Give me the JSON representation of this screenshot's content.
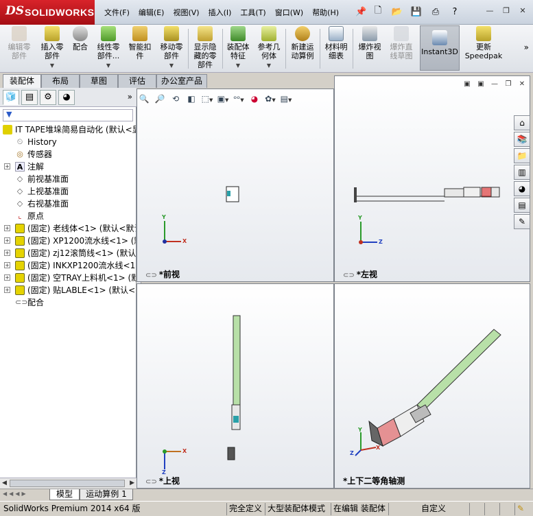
{
  "app": {
    "logo_ds": "DS",
    "logo_name": "SOLIDWORKS"
  },
  "menu": [
    "文件(F)",
    "编辑(E)",
    "视图(V)",
    "插入(I)",
    "工具(T)",
    "窗口(W)",
    "帮助(H)"
  ],
  "quick": [
    "new-icon",
    "open-icon",
    "save-icon",
    "print-icon",
    "help-icon"
  ],
  "command_manager": {
    "buttons": [
      {
        "label": "编辑零\n部件",
        "disabled": true
      },
      {
        "label": "插入零\n部件",
        "disabled": false
      },
      {
        "label": "配合",
        "disabled": false
      },
      {
        "label": "线性零\n部件...",
        "disabled": false
      },
      {
        "label": "智能扣\n件",
        "disabled": false
      },
      {
        "label": "移动零\n部件",
        "disabled": false
      },
      {
        "label": "显示隐\n藏的零\n部件",
        "disabled": false
      },
      {
        "label": "装配体\n特征",
        "disabled": false
      },
      {
        "label": "参考几\n何体",
        "disabled": false
      },
      {
        "label": "新建运\n动算例",
        "disabled": false
      },
      {
        "label": "材料明\n细表",
        "disabled": false
      },
      {
        "label": "爆炸视\n图",
        "disabled": false
      },
      {
        "label": "爆炸直\n线草图",
        "disabled": true
      },
      {
        "label": "Instant3D",
        "disabled": false
      },
      {
        "label": "更新\nSpeedpak",
        "disabled": false
      }
    ],
    "tabs": [
      "装配体",
      "布局",
      "草图",
      "评估",
      "办公室产品"
    ],
    "active_tab": "装配体"
  },
  "feature_tree": {
    "root": "IT TAPE堆垛简易自动化 (默认<显",
    "items": [
      {
        "label": "History",
        "icon": "history-icon",
        "expand": false
      },
      {
        "label": "传感器",
        "icon": "sensor-icon",
        "expand": false
      },
      {
        "label": "注解",
        "icon": "annotation-icon",
        "expand": true
      },
      {
        "label": "前视基准面",
        "icon": "plane-icon",
        "expand": false
      },
      {
        "label": "上视基准面",
        "icon": "plane-icon",
        "expand": false
      },
      {
        "label": "右视基准面",
        "icon": "plane-icon",
        "expand": false
      },
      {
        "label": "原点",
        "icon": "origin-icon",
        "expand": false
      },
      {
        "label": "(固定) 老线体<1> (默认<默认",
        "icon": "part-icon",
        "expand": true
      },
      {
        "label": "(固定) XP1200流水线<1> (默认",
        "icon": "part-icon",
        "expand": true
      },
      {
        "label": "(固定) zj12滚筒线<1> (默认<默",
        "icon": "part-icon",
        "expand": true
      },
      {
        "label": "(固定) INKXP1200流水线<1> (",
        "icon": "part-icon",
        "expand": true
      },
      {
        "label": "(固定) 空TRAY上料机<1> (默认",
        "icon": "part-icon",
        "expand": true
      },
      {
        "label": "(固定) 贴LABLE<1> (默认<<默",
        "icon": "part-icon",
        "expand": true
      },
      {
        "label": "配合",
        "icon": "mates-icon",
        "expand": false
      }
    ]
  },
  "viewports": {
    "front": "前视",
    "left": "左视",
    "top": "上视",
    "iso": "上下二等角轴测"
  },
  "axes": {
    "x": "X",
    "y": "Y",
    "z": "Z"
  },
  "bottom_tabs": [
    "模型",
    "运动算例 1"
  ],
  "status": {
    "app": "SolidWorks Premium 2014 x64 版",
    "s1": "完全定义",
    "s2": "大型装配体模式",
    "s3": "在编辑 装配体",
    "s4": "自定义"
  },
  "colors": {
    "accent": "#d8232a",
    "model_green": "#b8e0a8"
  }
}
